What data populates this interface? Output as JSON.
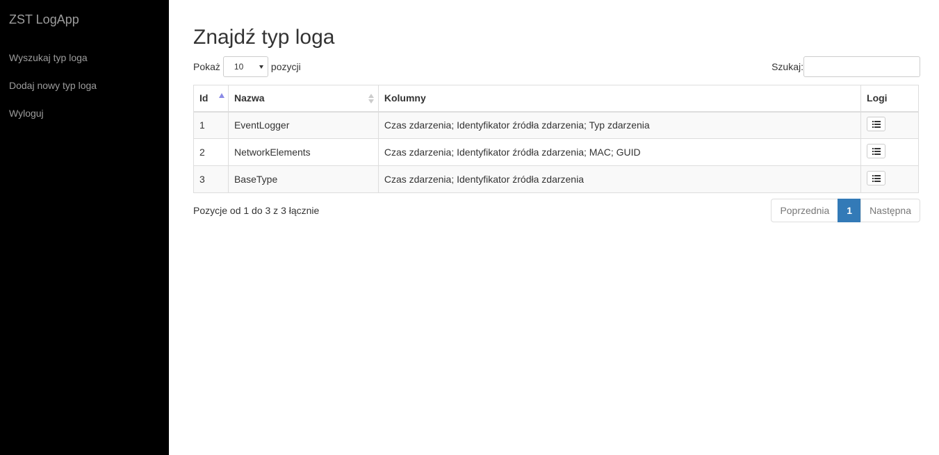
{
  "app": {
    "brand": "ZST LogApp"
  },
  "sidebar": {
    "items": [
      {
        "label": "Wyszukaj typ loga"
      },
      {
        "label": "Dodaj nowy typ loga"
      },
      {
        "label": "Wyloguj"
      }
    ]
  },
  "page": {
    "title": "Znajdź typ loga"
  },
  "length": {
    "prefix": "Pokaż",
    "value": "10",
    "suffix": "pozycji"
  },
  "search": {
    "label": "Szukaj:",
    "value": ""
  },
  "table": {
    "columns": [
      "Id",
      "Nazwa",
      "Kolumny",
      "Logi"
    ],
    "rows": [
      {
        "id": "1",
        "name": "EventLogger",
        "columns": "Czas zdarzenia; Identyfikator źródła zdarzenia; Typ zdarzenia"
      },
      {
        "id": "2",
        "name": "NetworkElements",
        "columns": "Czas zdarzenia; Identyfikator źródła zdarzenia; MAC; GUID"
      },
      {
        "id": "3",
        "name": "BaseType",
        "columns": "Czas zdarzenia; Identyfikator źródła zdarzenia"
      }
    ],
    "logs_icon": "list-icon"
  },
  "footer": {
    "info": "Pozycje od 1 do 3 z 3 łącznie"
  },
  "pagination": {
    "previous": "Poprzednia",
    "current": "1",
    "next": "Następna",
    "active_color": "#337ab7"
  }
}
